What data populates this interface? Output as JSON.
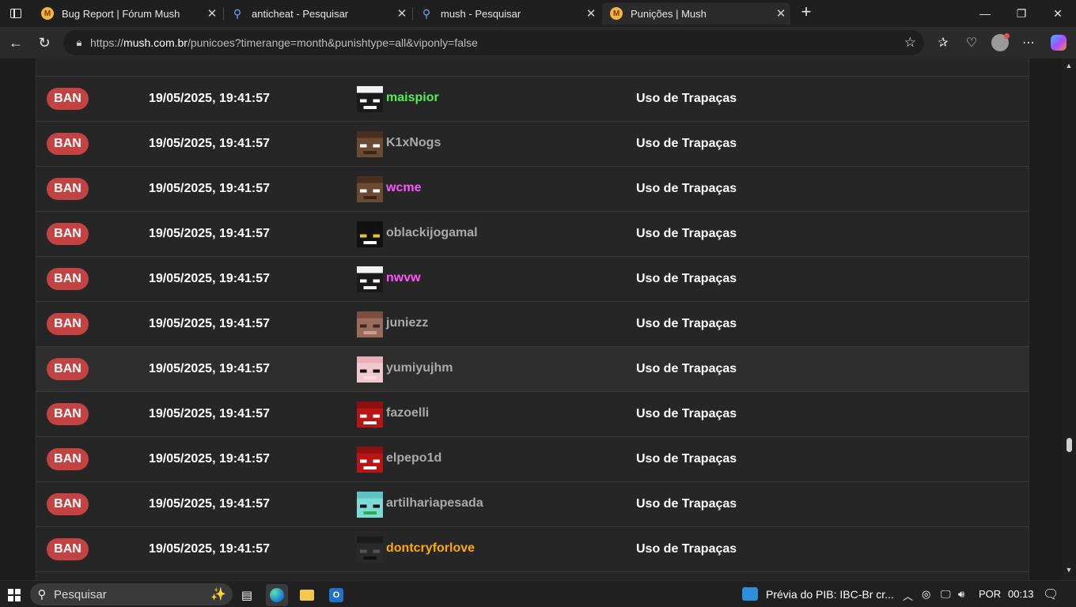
{
  "browser": {
    "tabs": [
      {
        "title": "Bug Report | Fórum Mush",
        "icon": "mush-icon",
        "active": false
      },
      {
        "title": "anticheat - Pesquisar",
        "icon": "search-icon",
        "active": false
      },
      {
        "title": "mush - Pesquisar",
        "icon": "search-icon",
        "active": false
      },
      {
        "title": "Punições | Mush",
        "icon": "mush-icon",
        "active": true
      }
    ],
    "url_prefix": "https://",
    "url_domain": "mush.com.br",
    "url_rest": "/punicoes?timerange=month&punishtype=all&viponly=false"
  },
  "punishments": {
    "rows": [
      {
        "type": "BAN",
        "date": "19/05/2025, 19:41:57",
        "nick": "maispior",
        "nick_color": "#55ee55",
        "reason": "Uso de Trapaças",
        "skin": "dark-white"
      },
      {
        "type": "BAN",
        "date": "19/05/2025, 19:41:57",
        "nick": "K1xNogs",
        "nick_color": "#aaaaaa",
        "reason": "Uso de Trapaças",
        "skin": "steve"
      },
      {
        "type": "BAN",
        "date": "19/05/2025, 19:41:57",
        "nick": "wcme",
        "nick_color": "#ff55ff",
        "reason": "Uso de Trapaças",
        "skin": "steve"
      },
      {
        "type": "BAN",
        "date": "19/05/2025, 19:41:57",
        "nick": "oblackijogamal",
        "nick_color": "#aaaaaa",
        "reason": "Uso de Trapaças",
        "skin": "cat"
      },
      {
        "type": "BAN",
        "date": "19/05/2025, 19:41:57",
        "nick": "nwvw",
        "nick_color": "#ff55ff",
        "reason": "Uso de Trapaças",
        "skin": "dark-white"
      },
      {
        "type": "BAN",
        "date": "19/05/2025, 19:41:57",
        "nick": "juniezz",
        "nick_color": "#aaaaaa",
        "reason": "Uso de Trapaças",
        "skin": "brown"
      },
      {
        "type": "BAN",
        "date": "19/05/2025, 19:41:57",
        "nick": "yumiyujhm",
        "nick_color": "#aaaaaa",
        "reason": "Uso de Trapaças",
        "skin": "pink",
        "hover": true
      },
      {
        "type": "BAN",
        "date": "19/05/2025, 19:41:57",
        "nick": "fazoelli",
        "nick_color": "#aaaaaa",
        "reason": "Uso de Trapaças",
        "skin": "red"
      },
      {
        "type": "BAN",
        "date": "19/05/2025, 19:41:57",
        "nick": "elpepo1d",
        "nick_color": "#aaaaaa",
        "reason": "Uso de Trapaças",
        "skin": "red"
      },
      {
        "type": "BAN",
        "date": "19/05/2025, 19:41:57",
        "nick": "artilhariapesada",
        "nick_color": "#aaaaaa",
        "reason": "Uso de Trapaças",
        "skin": "cyan"
      },
      {
        "type": "BAN",
        "date": "19/05/2025, 19:41:57",
        "nick": "dontcryforlove",
        "nick_color": "#ffaa00",
        "reason": "Uso de Trapaças",
        "skin": "dark"
      }
    ]
  },
  "taskbar": {
    "search_placeholder": "Pesquisar",
    "news": "Prévia do PIB: IBC-Br cr...",
    "language": "POR",
    "time": "00:13"
  }
}
